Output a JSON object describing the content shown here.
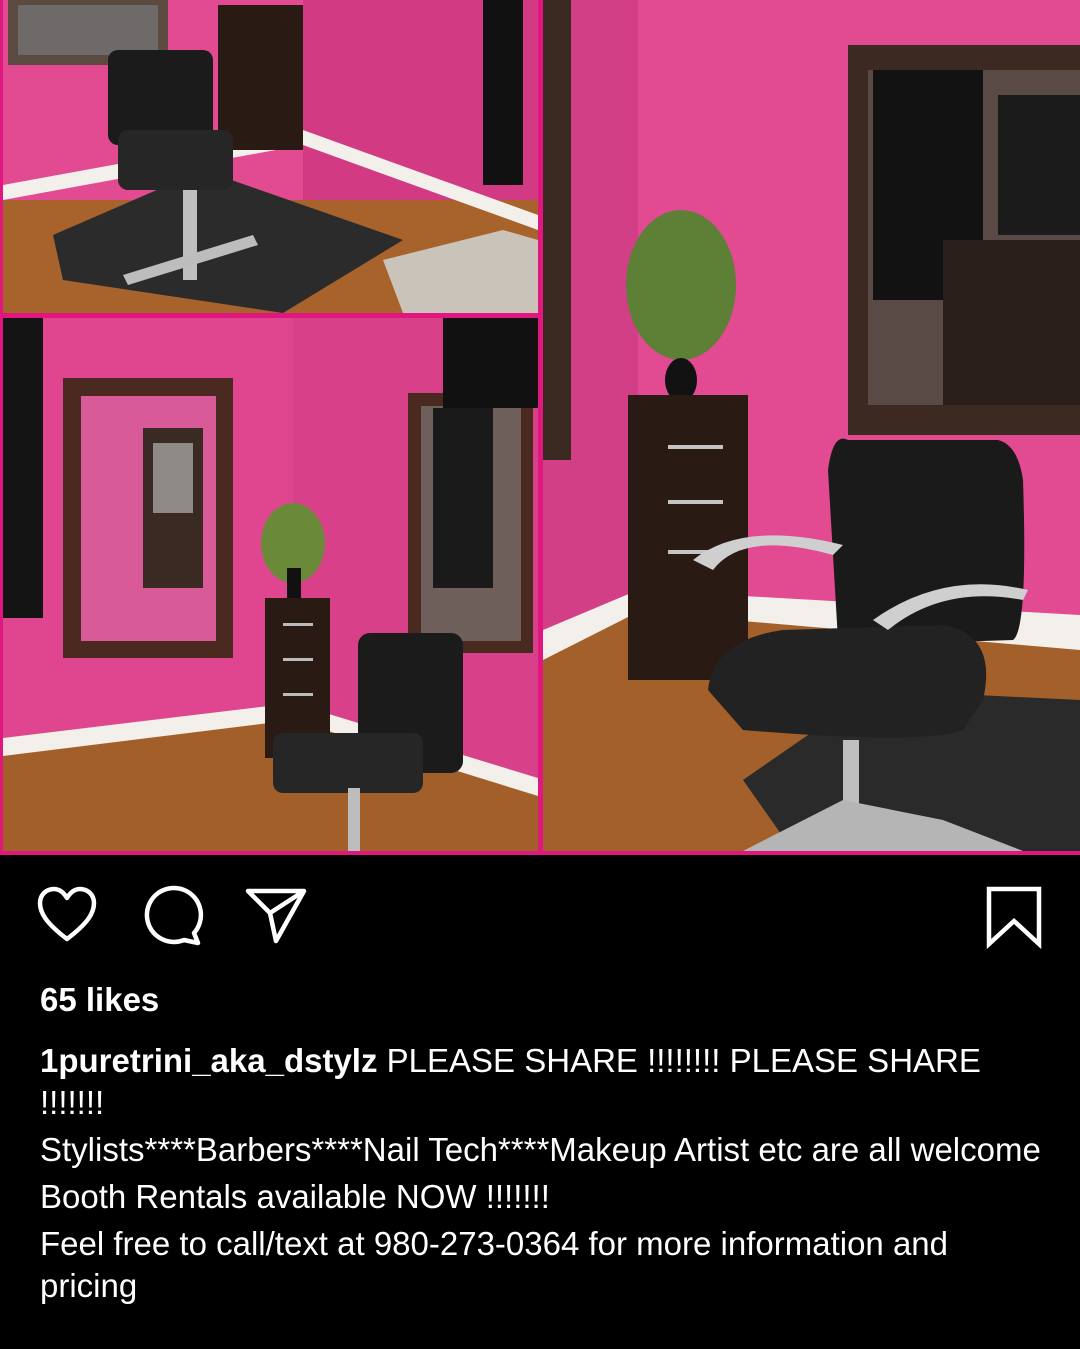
{
  "post": {
    "images": [
      {
        "name": "salon-photo-top-left",
        "description_icon": "photo"
      },
      {
        "name": "salon-photo-bottom-left",
        "description_icon": "photo"
      },
      {
        "name": "salon-photo-right",
        "description_icon": "photo"
      }
    ],
    "actions": {
      "like_icon": "heart-icon",
      "comment_icon": "comment-icon",
      "share_icon": "send-icon",
      "save_icon": "bookmark-icon"
    },
    "likes": "65 likes",
    "caption": {
      "username": "1puretrini_aka_dstylz",
      "line1": " PLEASE SHARE !!!!!!!! PLEASE SHARE !!!!!!!",
      "line2": "Stylists****Barbers****Nail Tech****Makeup Artist etc are all welcome",
      "line3": "Booth Rentals available NOW !!!!!!!",
      "line4": "Feel free to call/text at 980-273-0364 for more information and pricing"
    },
    "colors": {
      "wall_pink": "#e0468f",
      "frame_border": "#e0177f",
      "background": "#000000",
      "text": "#ffffff"
    }
  }
}
